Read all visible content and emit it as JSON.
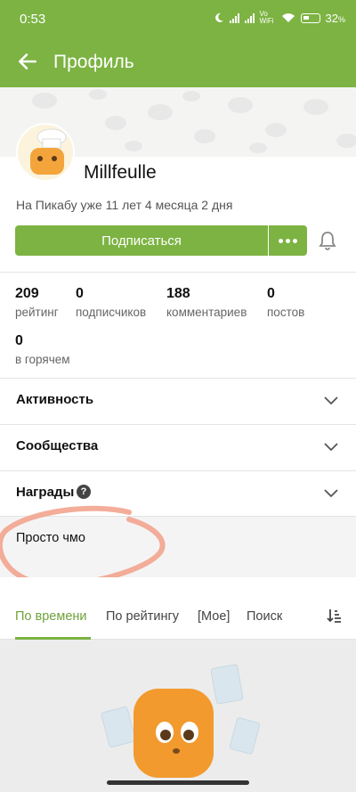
{
  "status_bar": {
    "time": "0:53",
    "vowifi": "Vo WiFi",
    "battery": "32",
    "battery_suffix": "%"
  },
  "app_bar": {
    "title": "Профиль",
    "back_icon": "arrow-left-icon"
  },
  "profile": {
    "username": "Millfeulle",
    "since": "На Пикабу уже 11 лет 4 месяца 2 дня",
    "subscribe_label": "Подписаться",
    "more_icon": "dots-icon",
    "bell_icon": "bell-icon"
  },
  "stats": [
    {
      "value": "209",
      "label": "рейтинг"
    },
    {
      "value": "0",
      "label": "подписчиков"
    },
    {
      "value": "188",
      "label": "комментариев"
    },
    {
      "value": "0",
      "label": "постов"
    },
    {
      "value": "0",
      "label": "в горячем"
    }
  ],
  "sections": {
    "activity": "Активность",
    "communities": "Сообщества",
    "awards": "Награды",
    "awards_help": "?"
  },
  "note": "Просто чмо",
  "tabs": [
    "По времени",
    "По рейтингу",
    "[Мое]",
    "Поиск"
  ],
  "sort_icon": "sort-icon",
  "colors": {
    "brand": "#7cb342",
    "scribble": "#f2a48e"
  }
}
